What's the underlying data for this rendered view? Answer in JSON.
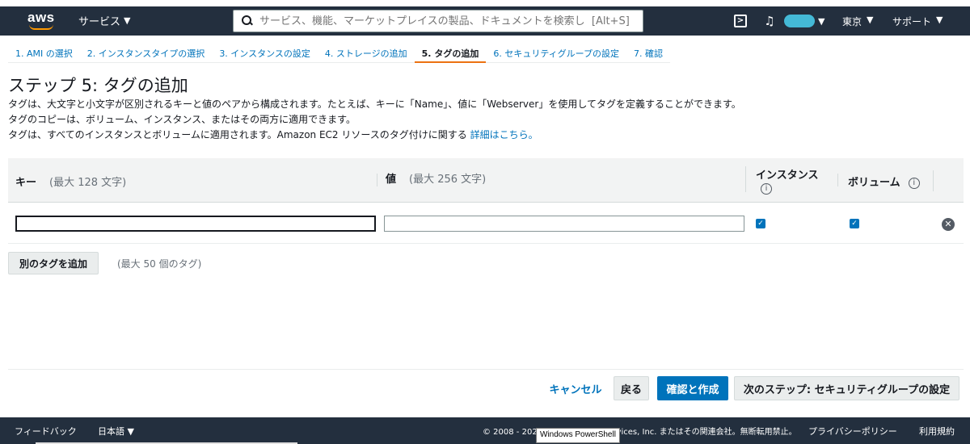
{
  "colors": {
    "navbar": "#232f3e",
    "accent": "#ec7211",
    "link": "#0073bb",
    "primary_button": "#0073bb"
  },
  "navbar": {
    "logo_text": "aws",
    "services_label": "サービス",
    "search_placeholder": "サービス、機能、マーケットプレイスの製品、ドキュメントを検索し  [Alt+S]",
    "region_label": "東京",
    "support_label": "サポート",
    "icons": [
      "search-icon",
      "cloudshell-icon",
      "bell-icon",
      "chevron-down-icon"
    ]
  },
  "steps": [
    {
      "label": "1. AMI の選択",
      "active": false
    },
    {
      "label": "2. インスタンスタイプの選択",
      "active": false
    },
    {
      "label": "3. インスタンスの設定",
      "active": false
    },
    {
      "label": "4. ストレージの追加",
      "active": false
    },
    {
      "label": "5. タグの追加",
      "active": true
    },
    {
      "label": "6. セキュリティグループの設定",
      "active": false
    },
    {
      "label": "7. 確認",
      "active": false
    }
  ],
  "page": {
    "title": "ステップ 5: タグの追加",
    "desc1": "タグは、大文字と小文字が区別されるキーと値のペアから構成されます。たとえば、キーに「Name」、値に「Webserver」を使用してタグを定義することができます。",
    "desc2": "タグのコピーは、ボリューム、インスタンス、またはその両方に適用できます。",
    "desc3_text": "タグは、すべてのインスタンスとボリュームに適用されます。Amazon EC2 リソースのタグ付けに関する ",
    "desc3_link": "詳細はこちら。"
  },
  "table": {
    "key_header": "キー",
    "key_hint": "(最大 128 文字)",
    "value_header": "値",
    "value_hint": "(最大 256 文字)",
    "instance_header": "インスタンス",
    "volume_header": "ボリューム",
    "info_symbol": "i",
    "rows": [
      {
        "key": "",
        "value": "",
        "instance_checked": true,
        "volume_checked": true
      }
    ]
  },
  "actions": {
    "add_tag_label": "別のタグを追加",
    "add_tag_hint": "(最大 50 個のタグ)",
    "cancel_label": "キャンセル",
    "back_label": "戻る",
    "review_label": "確認と作成",
    "next_label": "次のステップ: セキュリティグループの設定"
  },
  "footer": {
    "feedback_label": "フィードバック",
    "language_label": "日本語",
    "copyright": "© 2008 - 2021, Amazon Web Services, Inc. またはその関連会社。無断転用禁止。",
    "privacy_label": "プライバシーポリシー",
    "terms_label": "利用規約"
  },
  "tooltip": "Windows PowerShell"
}
